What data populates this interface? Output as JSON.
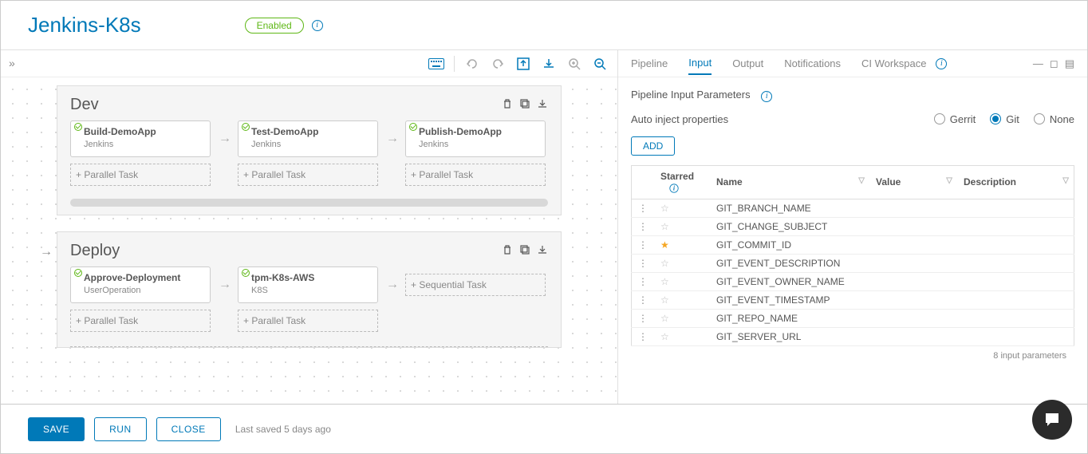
{
  "header": {
    "title": "Jenkins-K8s",
    "status": "Enabled"
  },
  "canvas": {
    "parallel_task_label": "+ Parallel Task",
    "sequential_task_label": "+ Sequential Task",
    "stages": [
      {
        "name": "Dev",
        "tasks": [
          {
            "title": "Build-DemoApp",
            "subtitle": "Jenkins"
          },
          {
            "title": "Test-DemoApp",
            "subtitle": "Jenkins"
          },
          {
            "title": "Publish-DemoApp",
            "subtitle": "Jenkins"
          }
        ]
      },
      {
        "name": "Deploy",
        "tasks": [
          {
            "title": "Approve-Deployment",
            "subtitle": "UserOperation"
          },
          {
            "title": "tpm-K8s-AWS",
            "subtitle": "K8S"
          }
        ]
      }
    ]
  },
  "side": {
    "tabs": {
      "pipeline": "Pipeline",
      "input": "Input",
      "output": "Output",
      "notifications": "Notifications",
      "ci_workspace": "CI Workspace"
    },
    "section_title": "Pipeline Input Parameters",
    "auto_inject_label": "Auto inject properties",
    "radios": {
      "gerrit": "Gerrit",
      "git": "Git",
      "none": "None"
    },
    "selected_radio": "git",
    "add_button": "ADD",
    "columns": {
      "starred": "Starred",
      "name": "Name",
      "value": "Value",
      "description": "Description"
    },
    "rows": [
      {
        "starred": false,
        "name": "GIT_BRANCH_NAME",
        "value": "",
        "description": ""
      },
      {
        "starred": false,
        "name": "GIT_CHANGE_SUBJECT",
        "value": "",
        "description": ""
      },
      {
        "starred": true,
        "name": "GIT_COMMIT_ID",
        "value": "",
        "description": ""
      },
      {
        "starred": false,
        "name": "GIT_EVENT_DESCRIPTION",
        "value": "",
        "description": ""
      },
      {
        "starred": false,
        "name": "GIT_EVENT_OWNER_NAME",
        "value": "",
        "description": ""
      },
      {
        "starred": false,
        "name": "GIT_EVENT_TIMESTAMP",
        "value": "",
        "description": ""
      },
      {
        "starred": false,
        "name": "GIT_REPO_NAME",
        "value": "",
        "description": ""
      },
      {
        "starred": false,
        "name": "GIT_SERVER_URL",
        "value": "",
        "description": ""
      }
    ],
    "footer_count": "8 input parameters"
  },
  "footer": {
    "save": "SAVE",
    "run": "RUN",
    "close": "CLOSE",
    "last_saved": "Last saved 5 days ago"
  }
}
